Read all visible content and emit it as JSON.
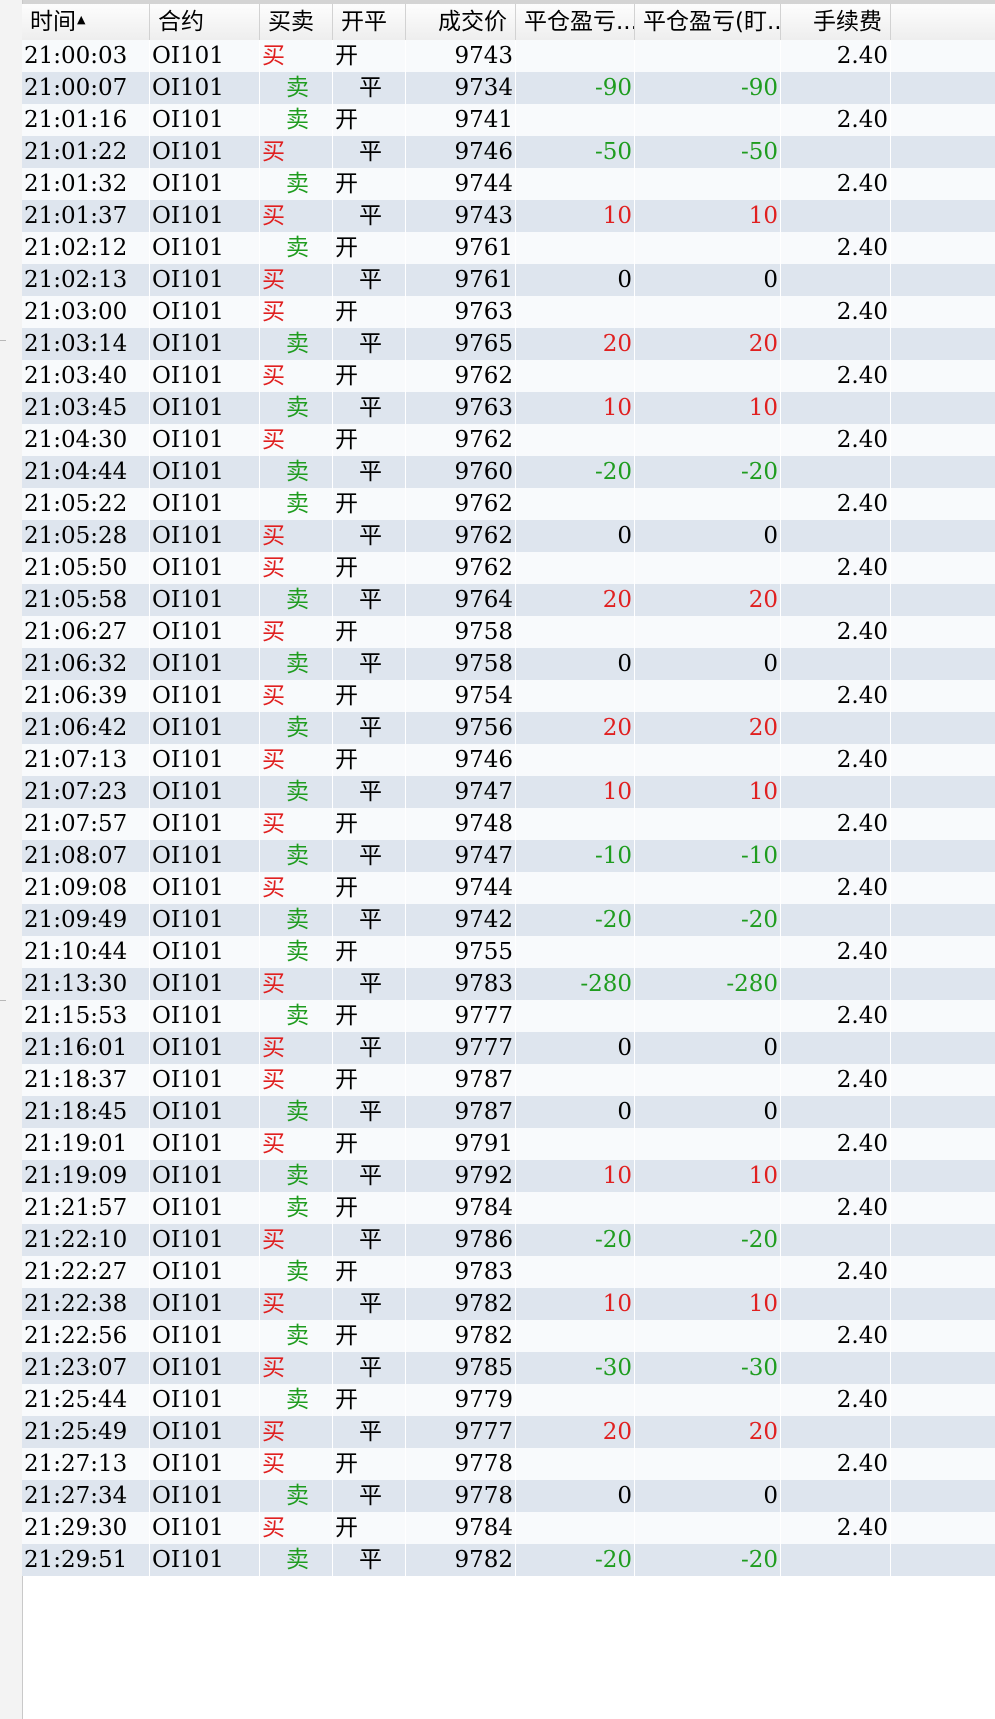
{
  "colors": {
    "buy": "#e02020",
    "sell": "#1f9c1f",
    "profit": "#e02020",
    "loss": "#1f9c1f",
    "row_alt": "#dee5ee",
    "row_plain": "#f8fafc"
  },
  "sort": {
    "column": "time",
    "direction": "ascending",
    "icon": "sort-ascending-icon"
  },
  "table": {
    "headers": {
      "time": "时间",
      "contract": "合约",
      "side": "买卖",
      "offset": "开平",
      "price": "成交价",
      "pnl": "平仓盈亏...",
      "pnl_mark": "平仓盈亏(盯...",
      "fee": "手续费"
    },
    "rows": [
      {
        "time": "21:00:03",
        "contract": "OI101",
        "side": "买",
        "offset": "开",
        "price": "9743",
        "pnl": "",
        "pnl_mark": "",
        "fee": "2.40"
      },
      {
        "time": "21:00:07",
        "contract": "OI101",
        "side": "卖",
        "offset": "平",
        "price": "9734",
        "pnl": "-90",
        "pnl_mark": "-90",
        "fee": ""
      },
      {
        "time": "21:01:16",
        "contract": "OI101",
        "side": "卖",
        "offset": "开",
        "price": "9741",
        "pnl": "",
        "pnl_mark": "",
        "fee": "2.40"
      },
      {
        "time": "21:01:22",
        "contract": "OI101",
        "side": "买",
        "offset": "平",
        "price": "9746",
        "pnl": "-50",
        "pnl_mark": "-50",
        "fee": ""
      },
      {
        "time": "21:01:32",
        "contract": "OI101",
        "side": "卖",
        "offset": "开",
        "price": "9744",
        "pnl": "",
        "pnl_mark": "",
        "fee": "2.40"
      },
      {
        "time": "21:01:37",
        "contract": "OI101",
        "side": "买",
        "offset": "平",
        "price": "9743",
        "pnl": "10",
        "pnl_mark": "10",
        "fee": ""
      },
      {
        "time": "21:02:12",
        "contract": "OI101",
        "side": "卖",
        "offset": "开",
        "price": "9761",
        "pnl": "",
        "pnl_mark": "",
        "fee": "2.40"
      },
      {
        "time": "21:02:13",
        "contract": "OI101",
        "side": "买",
        "offset": "平",
        "price": "9761",
        "pnl": "0",
        "pnl_mark": "0",
        "fee": ""
      },
      {
        "time": "21:03:00",
        "contract": "OI101",
        "side": "买",
        "offset": "开",
        "price": "9763",
        "pnl": "",
        "pnl_mark": "",
        "fee": "2.40"
      },
      {
        "time": "21:03:14",
        "contract": "OI101",
        "side": "卖",
        "offset": "平",
        "price": "9765",
        "pnl": "20",
        "pnl_mark": "20",
        "fee": ""
      },
      {
        "time": "21:03:40",
        "contract": "OI101",
        "side": "买",
        "offset": "开",
        "price": "9762",
        "pnl": "",
        "pnl_mark": "",
        "fee": "2.40"
      },
      {
        "time": "21:03:45",
        "contract": "OI101",
        "side": "卖",
        "offset": "平",
        "price": "9763",
        "pnl": "10",
        "pnl_mark": "10",
        "fee": ""
      },
      {
        "time": "21:04:30",
        "contract": "OI101",
        "side": "买",
        "offset": "开",
        "price": "9762",
        "pnl": "",
        "pnl_mark": "",
        "fee": "2.40"
      },
      {
        "time": "21:04:44",
        "contract": "OI101",
        "side": "卖",
        "offset": "平",
        "price": "9760",
        "pnl": "-20",
        "pnl_mark": "-20",
        "fee": ""
      },
      {
        "time": "21:05:22",
        "contract": "OI101",
        "side": "卖",
        "offset": "开",
        "price": "9762",
        "pnl": "",
        "pnl_mark": "",
        "fee": "2.40"
      },
      {
        "time": "21:05:28",
        "contract": "OI101",
        "side": "买",
        "offset": "平",
        "price": "9762",
        "pnl": "0",
        "pnl_mark": "0",
        "fee": ""
      },
      {
        "time": "21:05:50",
        "contract": "OI101",
        "side": "买",
        "offset": "开",
        "price": "9762",
        "pnl": "",
        "pnl_mark": "",
        "fee": "2.40"
      },
      {
        "time": "21:05:58",
        "contract": "OI101",
        "side": "卖",
        "offset": "平",
        "price": "9764",
        "pnl": "20",
        "pnl_mark": "20",
        "fee": ""
      },
      {
        "time": "21:06:27",
        "contract": "OI101",
        "side": "买",
        "offset": "开",
        "price": "9758",
        "pnl": "",
        "pnl_mark": "",
        "fee": "2.40"
      },
      {
        "time": "21:06:32",
        "contract": "OI101",
        "side": "卖",
        "offset": "平",
        "price": "9758",
        "pnl": "0",
        "pnl_mark": "0",
        "fee": ""
      },
      {
        "time": "21:06:39",
        "contract": "OI101",
        "side": "买",
        "offset": "开",
        "price": "9754",
        "pnl": "",
        "pnl_mark": "",
        "fee": "2.40"
      },
      {
        "time": "21:06:42",
        "contract": "OI101",
        "side": "卖",
        "offset": "平",
        "price": "9756",
        "pnl": "20",
        "pnl_mark": "20",
        "fee": ""
      },
      {
        "time": "21:07:13",
        "contract": "OI101",
        "side": "买",
        "offset": "开",
        "price": "9746",
        "pnl": "",
        "pnl_mark": "",
        "fee": "2.40"
      },
      {
        "time": "21:07:23",
        "contract": "OI101",
        "side": "卖",
        "offset": "平",
        "price": "9747",
        "pnl": "10",
        "pnl_mark": "10",
        "fee": ""
      },
      {
        "time": "21:07:57",
        "contract": "OI101",
        "side": "买",
        "offset": "开",
        "price": "9748",
        "pnl": "",
        "pnl_mark": "",
        "fee": "2.40"
      },
      {
        "time": "21:08:07",
        "contract": "OI101",
        "side": "卖",
        "offset": "平",
        "price": "9747",
        "pnl": "-10",
        "pnl_mark": "-10",
        "fee": ""
      },
      {
        "time": "21:09:08",
        "contract": "OI101",
        "side": "买",
        "offset": "开",
        "price": "9744",
        "pnl": "",
        "pnl_mark": "",
        "fee": "2.40"
      },
      {
        "time": "21:09:49",
        "contract": "OI101",
        "side": "卖",
        "offset": "平",
        "price": "9742",
        "pnl": "-20",
        "pnl_mark": "-20",
        "fee": ""
      },
      {
        "time": "21:10:44",
        "contract": "OI101",
        "side": "卖",
        "offset": "开",
        "price": "9755",
        "pnl": "",
        "pnl_mark": "",
        "fee": "2.40"
      },
      {
        "time": "21:13:30",
        "contract": "OI101",
        "side": "买",
        "offset": "平",
        "price": "9783",
        "pnl": "-280",
        "pnl_mark": "-280",
        "fee": ""
      },
      {
        "time": "21:15:53",
        "contract": "OI101",
        "side": "卖",
        "offset": "开",
        "price": "9777",
        "pnl": "",
        "pnl_mark": "",
        "fee": "2.40"
      },
      {
        "time": "21:16:01",
        "contract": "OI101",
        "side": "买",
        "offset": "平",
        "price": "9777",
        "pnl": "0",
        "pnl_mark": "0",
        "fee": ""
      },
      {
        "time": "21:18:37",
        "contract": "OI101",
        "side": "买",
        "offset": "开",
        "price": "9787",
        "pnl": "",
        "pnl_mark": "",
        "fee": "2.40"
      },
      {
        "time": "21:18:45",
        "contract": "OI101",
        "side": "卖",
        "offset": "平",
        "price": "9787",
        "pnl": "0",
        "pnl_mark": "0",
        "fee": ""
      },
      {
        "time": "21:19:01",
        "contract": "OI101",
        "side": "买",
        "offset": "开",
        "price": "9791",
        "pnl": "",
        "pnl_mark": "",
        "fee": "2.40"
      },
      {
        "time": "21:19:09",
        "contract": "OI101",
        "side": "卖",
        "offset": "平",
        "price": "9792",
        "pnl": "10",
        "pnl_mark": "10",
        "fee": ""
      },
      {
        "time": "21:21:57",
        "contract": "OI101",
        "side": "卖",
        "offset": "开",
        "price": "9784",
        "pnl": "",
        "pnl_mark": "",
        "fee": "2.40"
      },
      {
        "time": "21:22:10",
        "contract": "OI101",
        "side": "买",
        "offset": "平",
        "price": "9786",
        "pnl": "-20",
        "pnl_mark": "-20",
        "fee": ""
      },
      {
        "time": "21:22:27",
        "contract": "OI101",
        "side": "卖",
        "offset": "开",
        "price": "9783",
        "pnl": "",
        "pnl_mark": "",
        "fee": "2.40"
      },
      {
        "time": "21:22:38",
        "contract": "OI101",
        "side": "买",
        "offset": "平",
        "price": "9782",
        "pnl": "10",
        "pnl_mark": "10",
        "fee": ""
      },
      {
        "time": "21:22:56",
        "contract": "OI101",
        "side": "卖",
        "offset": "开",
        "price": "9782",
        "pnl": "",
        "pnl_mark": "",
        "fee": "2.40"
      },
      {
        "time": "21:23:07",
        "contract": "OI101",
        "side": "买",
        "offset": "平",
        "price": "9785",
        "pnl": "-30",
        "pnl_mark": "-30",
        "fee": ""
      },
      {
        "time": "21:25:44",
        "contract": "OI101",
        "side": "卖",
        "offset": "开",
        "price": "9779",
        "pnl": "",
        "pnl_mark": "",
        "fee": "2.40"
      },
      {
        "time": "21:25:49",
        "contract": "OI101",
        "side": "买",
        "offset": "平",
        "price": "9777",
        "pnl": "20",
        "pnl_mark": "20",
        "fee": ""
      },
      {
        "time": "21:27:13",
        "contract": "OI101",
        "side": "买",
        "offset": "开",
        "price": "9778",
        "pnl": "",
        "pnl_mark": "",
        "fee": "2.40"
      },
      {
        "time": "21:27:34",
        "contract": "OI101",
        "side": "卖",
        "offset": "平",
        "price": "9778",
        "pnl": "0",
        "pnl_mark": "0",
        "fee": ""
      },
      {
        "time": "21:29:30",
        "contract": "OI101",
        "side": "买",
        "offset": "开",
        "price": "9784",
        "pnl": "",
        "pnl_mark": "",
        "fee": "2.40"
      },
      {
        "time": "21:29:51",
        "contract": "OI101",
        "side": "卖",
        "offset": "平",
        "price": "9782",
        "pnl": "-20",
        "pnl_mark": "-20",
        "fee": ""
      }
    ]
  }
}
